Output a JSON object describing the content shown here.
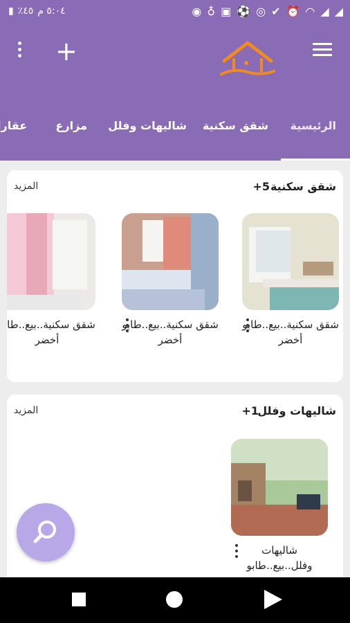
{
  "status_bar": {
    "time": "٥:٠٤ م",
    "battery": "٤٥٪",
    "icons": [
      "alarm-icon",
      "wifi-icon",
      "signal-icon",
      "signal-icon",
      "messenger-icon",
      "bulb-icon",
      "app-icon",
      "soccer-icon",
      "circle-icon",
      "brand-icon"
    ]
  },
  "app_bar": {
    "menu": "menu-icon",
    "add": "+",
    "more": "more-vertical-icon"
  },
  "tabs": [
    "الرئيسية",
    "شقق سكنية",
    "شاليهات وفلل",
    "مزارع",
    "عقارا"
  ],
  "sections": [
    {
      "title": "شقق سكنية",
      "count": "+5",
      "more": "المزيد",
      "items": [
        {
          "title": "شقق سكنية..بيع..طابو أخضر"
        },
        {
          "title": "شقق سكنية..بيع..طابو أخضر"
        },
        {
          "title": "شقق سكنية..بيع..طابو أخضر"
        }
      ]
    },
    {
      "title": "شاليهات وفلل",
      "count": "+1",
      "more": "المزيد",
      "items": [
        {
          "title": "شاليهات وفلل..بيع..طابو"
        }
      ]
    }
  ],
  "colors": {
    "primary": "#8a6bb5",
    "fab": "#b9a8e8",
    "logo": "#f08a24"
  }
}
